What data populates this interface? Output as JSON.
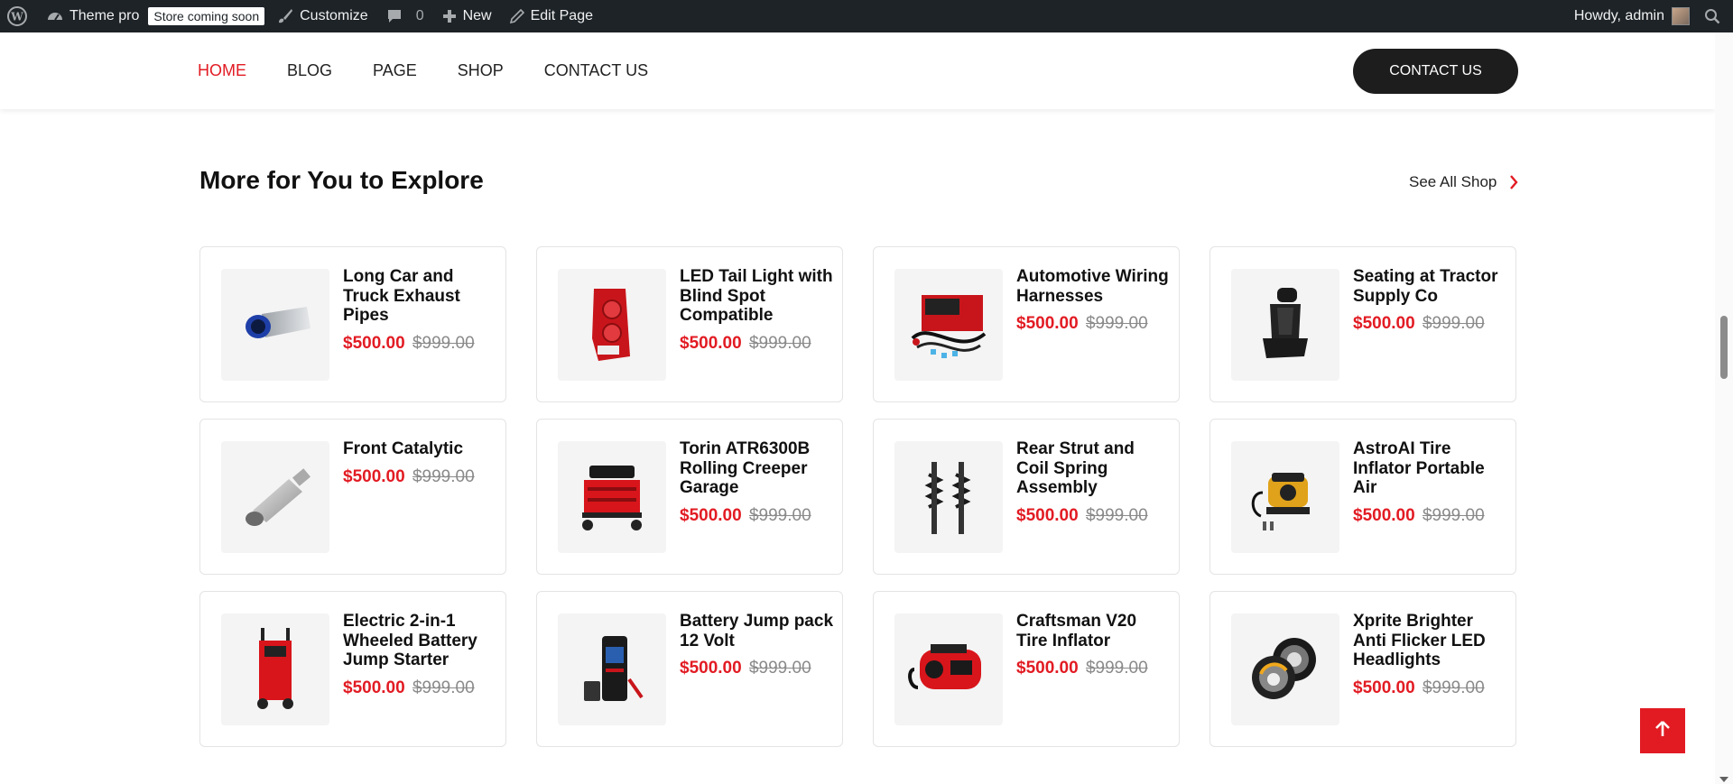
{
  "adminbar": {
    "site_name": "Theme pro",
    "store_badge": "Store coming soon",
    "customize": "Customize",
    "comments_count": "0",
    "new": "New",
    "edit_page": "Edit Page",
    "howdy": "Howdy, admin"
  },
  "nav": {
    "items": [
      "HOME",
      "BLOG",
      "PAGE",
      "SHOP",
      "CONTACT US"
    ],
    "active": "HOME",
    "cta": "CONTACT US"
  },
  "section": {
    "title": "More for You to Explore",
    "see_all": "See All Shop"
  },
  "products": [
    {
      "name": "Long Car and Truck Exhaust Pipes",
      "price": "$500.00",
      "old_price": "$999.00",
      "icon": "exhaust-pipe-icon"
    },
    {
      "name": "LED Tail Light with Blind Spot Compatible",
      "price": "$500.00",
      "old_price": "$999.00",
      "icon": "tail-light-icon"
    },
    {
      "name": "Automotive Wiring Harnesses",
      "price": "$500.00",
      "old_price": "$999.00",
      "icon": "wiring-harness-icon"
    },
    {
      "name": "Seating at Tractor Supply Co",
      "price": "$500.00",
      "old_price": "$999.00",
      "icon": "car-seat-icon"
    },
    {
      "name": "Front Catalytic",
      "price": "$500.00",
      "old_price": "$999.00",
      "icon": "catalytic-converter-icon"
    },
    {
      "name": "Torin ATR6300B Rolling Creeper Garage",
      "price": "$500.00",
      "old_price": "$999.00",
      "icon": "creeper-seat-icon"
    },
    {
      "name": "Rear Strut and Coil Spring Assembly",
      "price": "$500.00",
      "old_price": "$999.00",
      "icon": "coil-spring-icon"
    },
    {
      "name": "AstroAI Tire Inflator Portable Air",
      "price": "$500.00",
      "old_price": "$999.00",
      "icon": "tire-inflator-icon"
    },
    {
      "name": "Electric 2-in-1 Wheeled Battery Jump Starter",
      "price": "$500.00",
      "old_price": "$999.00",
      "icon": "battery-charger-icon"
    },
    {
      "name": "Battery Jump pack 12 Volt",
      "price": "$500.00",
      "old_price": "$999.00",
      "icon": "jump-pack-icon"
    },
    {
      "name": "Craftsman V20 Tire Inflator",
      "price": "$500.00",
      "old_price": "$999.00",
      "icon": "inflator-icon"
    },
    {
      "name": "Xprite Brighter Anti Flicker LED Headlights",
      "price": "$500.00",
      "old_price": "$999.00",
      "icon": "headlights-icon"
    }
  ],
  "colors": {
    "accent": "#e21b23",
    "dark": "#1d1d1d",
    "adminbar": "#1d2327"
  }
}
